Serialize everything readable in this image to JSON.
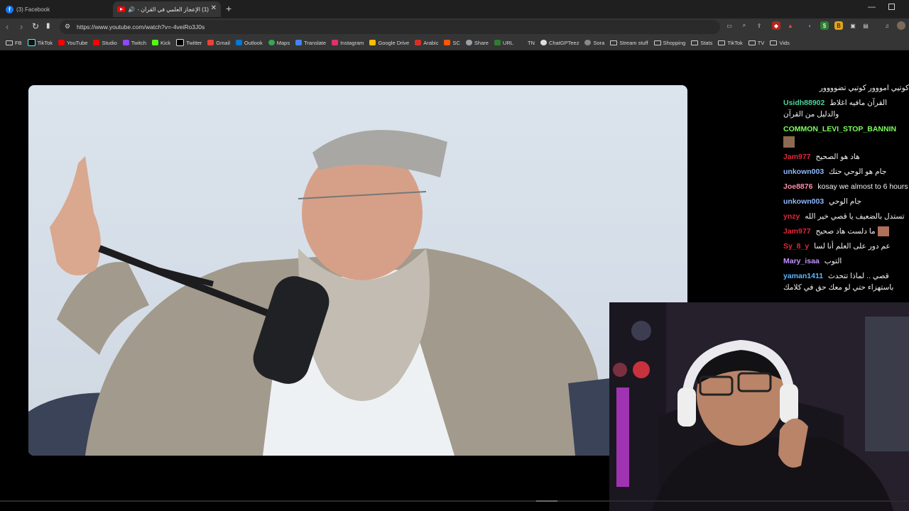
{
  "tabs": [
    {
      "title": "(3) Facebook",
      "favicon": "facebook-icon",
      "active": false
    },
    {
      "title": "(1) الإعجاز العلمي في القرآن - ...",
      "favicon": "youtube-icon",
      "active": true,
      "audio": "speaker-icon"
    }
  ],
  "toolbar": {
    "url": "https://www.youtube.com/watch?v=-4veiRo3J0s"
  },
  "bookmarks": [
    {
      "label": "FB",
      "icon": "folder-icon"
    },
    {
      "label": "TikTok",
      "icon": "tiktok-icon"
    },
    {
      "label": "YouTube",
      "icon": "youtube-icon"
    },
    {
      "label": "Studio",
      "icon": "youtube-studio-icon"
    },
    {
      "label": "Twitch",
      "icon": "twitch-icon"
    },
    {
      "label": "Kick",
      "icon": "kick-icon"
    },
    {
      "label": "Twitter",
      "icon": "x-icon"
    },
    {
      "label": "Gmail",
      "icon": "gmail-icon"
    },
    {
      "label": "Outlook",
      "icon": "outlook-icon"
    },
    {
      "label": "Maps",
      "icon": "maps-icon"
    },
    {
      "label": "Translate",
      "icon": "translate-icon"
    },
    {
      "label": "Instagram",
      "icon": "instagram-icon"
    },
    {
      "label": "Google Drive",
      "icon": "drive-icon"
    },
    {
      "label": "Arabic",
      "icon": "arabic-icon"
    },
    {
      "label": "SC",
      "icon": "sc-icon"
    },
    {
      "label": "Share",
      "icon": "cloud-icon"
    },
    {
      "label": "URL",
      "icon": "url-icon"
    },
    {
      "label": "TN",
      "icon": "tn-icon"
    },
    {
      "label": "ChatGPTeez",
      "icon": "chatgpt-icon"
    },
    {
      "label": "Sora",
      "icon": "sora-icon"
    },
    {
      "label": "Stream stuff",
      "icon": "folder-icon"
    },
    {
      "label": "Shopping",
      "icon": "folder-icon"
    },
    {
      "label": "Stats",
      "icon": "folder-icon"
    },
    {
      "label": "TikTok",
      "icon": "folder-icon"
    },
    {
      "label": "TV",
      "icon": "folder-icon"
    },
    {
      "label": "Vids",
      "icon": "folder-icon"
    }
  ],
  "chat": [
    {
      "user": "",
      "color": "#ffffff",
      "text": "كوتيي امووور كوتيي تضوووور"
    },
    {
      "user": "Usidh88902",
      "color": "#4cd39b",
      "text": "القرآن مافيه اغلاط والدليل من القرآن"
    },
    {
      "user": "COMMON_LEVI_STOP_BANNIN",
      "color": "#7cff5a",
      "text": ""
    },
    {
      "user": "Jam977",
      "color": "#e0283c",
      "text": "هاد هو الصحيح"
    },
    {
      "user": "unkown003",
      "color": "#8fb8ff",
      "text": "جام هو الوحي حتك"
    },
    {
      "user": "Joe8876",
      "color": "#ff8fa8",
      "text": "kosay we almost to 6 hours"
    },
    {
      "user": "unkown003",
      "color": "#8fb8ff",
      "text": "جام الوحي"
    },
    {
      "user": "ynzy",
      "color": "#e0283c",
      "text": "تستدل بالضعيف يا قصي خير الله"
    },
    {
      "user": "Jam977",
      "color": "#e0283c",
      "text": "ما دلست هاد صحيح"
    },
    {
      "user": "Sy_8_y",
      "color": "#e0283c",
      "text": "عم دور على العلم أنا لسا"
    },
    {
      "user": "Mary_isaa",
      "color": "#c592ff",
      "text": "التوب"
    },
    {
      "user": "yaman1411",
      "color": "#5ab8ff",
      "text": "قصي .. لماذا تتحدث باستهزاء حتي لو معك حق في كلامك"
    }
  ]
}
